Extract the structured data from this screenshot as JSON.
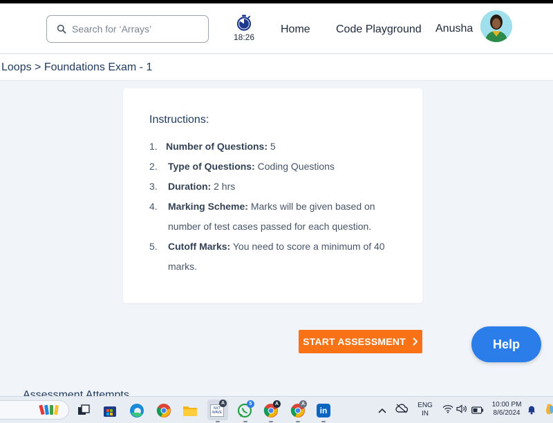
{
  "header": {
    "search_placeholder": "Search for ‘Arrays’",
    "timer": "18:26",
    "nav": {
      "home": "Home",
      "code_playground": "Code Playground"
    },
    "user_name": "Anusha"
  },
  "breadcrumb": "Loops > Foundations Exam - 1",
  "instructions": {
    "title": "Instructions:",
    "items": [
      {
        "num": "1.",
        "label": "Number of Questions:",
        "value": " 5"
      },
      {
        "num": "2.",
        "label": "Type of Questions:",
        "value": " Coding Questions"
      },
      {
        "num": "3.",
        "label": "Duration:",
        "value": " 2 hrs"
      },
      {
        "num": "4.",
        "label": "Marking Scheme:",
        "value": " Marks will be given based on number of test cases passed for each question."
      },
      {
        "num": "5.",
        "label": "Cutoff Marks:",
        "value": " You need to score a minimum of 40 marks."
      }
    ]
  },
  "actions": {
    "start": "START ASSESSMENT",
    "help": "Help"
  },
  "attempts_heading": "Assessment Attempts",
  "taskbar": {
    "language": "ENG",
    "region": "IN",
    "time": "10:00 PM",
    "date": "8/6/2024",
    "whatsapp_badge": "5",
    "chrome_badge_1": "A",
    "chrome_badge_2": "A",
    "ccbp_badge": "A"
  },
  "colors": {
    "accent_orange": "#f97316",
    "help_blue": "#2b7de9",
    "text_dark": "#1e3a5f"
  }
}
